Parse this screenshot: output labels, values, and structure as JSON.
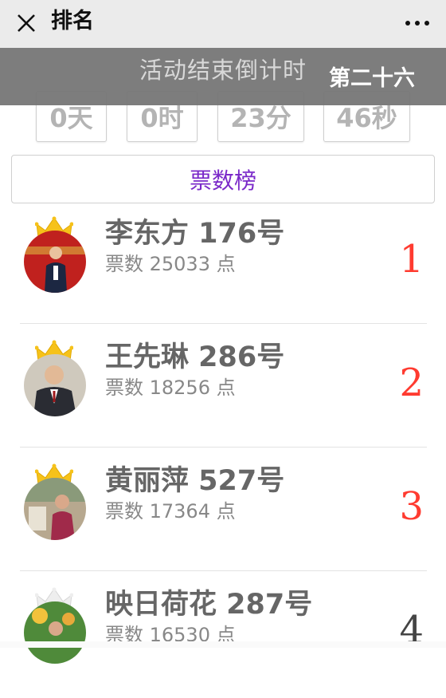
{
  "navbar": {
    "title": "排名",
    "close_icon": "close-icon",
    "more_icon": "more-icon"
  },
  "banner": {
    "title": "活动结束倒计时",
    "marquee": "第二十六"
  },
  "countdown": {
    "days": "0天",
    "hours": "0时",
    "minutes": "23分",
    "seconds": "46秒"
  },
  "tab": {
    "label": "票数榜"
  },
  "colors": {
    "tab_text": "#7b2ac9",
    "rank_top": "#ff3b30",
    "crown_gold": "#f6c21a"
  },
  "rankings": [
    {
      "name": "李东方  176号",
      "votes": "票数 25033   点",
      "rank": "1"
    },
    {
      "name": "王先琳  286号",
      "votes": "票数 18256   点",
      "rank": "2"
    },
    {
      "name": "黄丽萍  527号",
      "votes": "票数 17364   点",
      "rank": "3"
    },
    {
      "name": "映日荷花  287号",
      "votes": "票数 16530   点",
      "rank": "4"
    }
  ]
}
